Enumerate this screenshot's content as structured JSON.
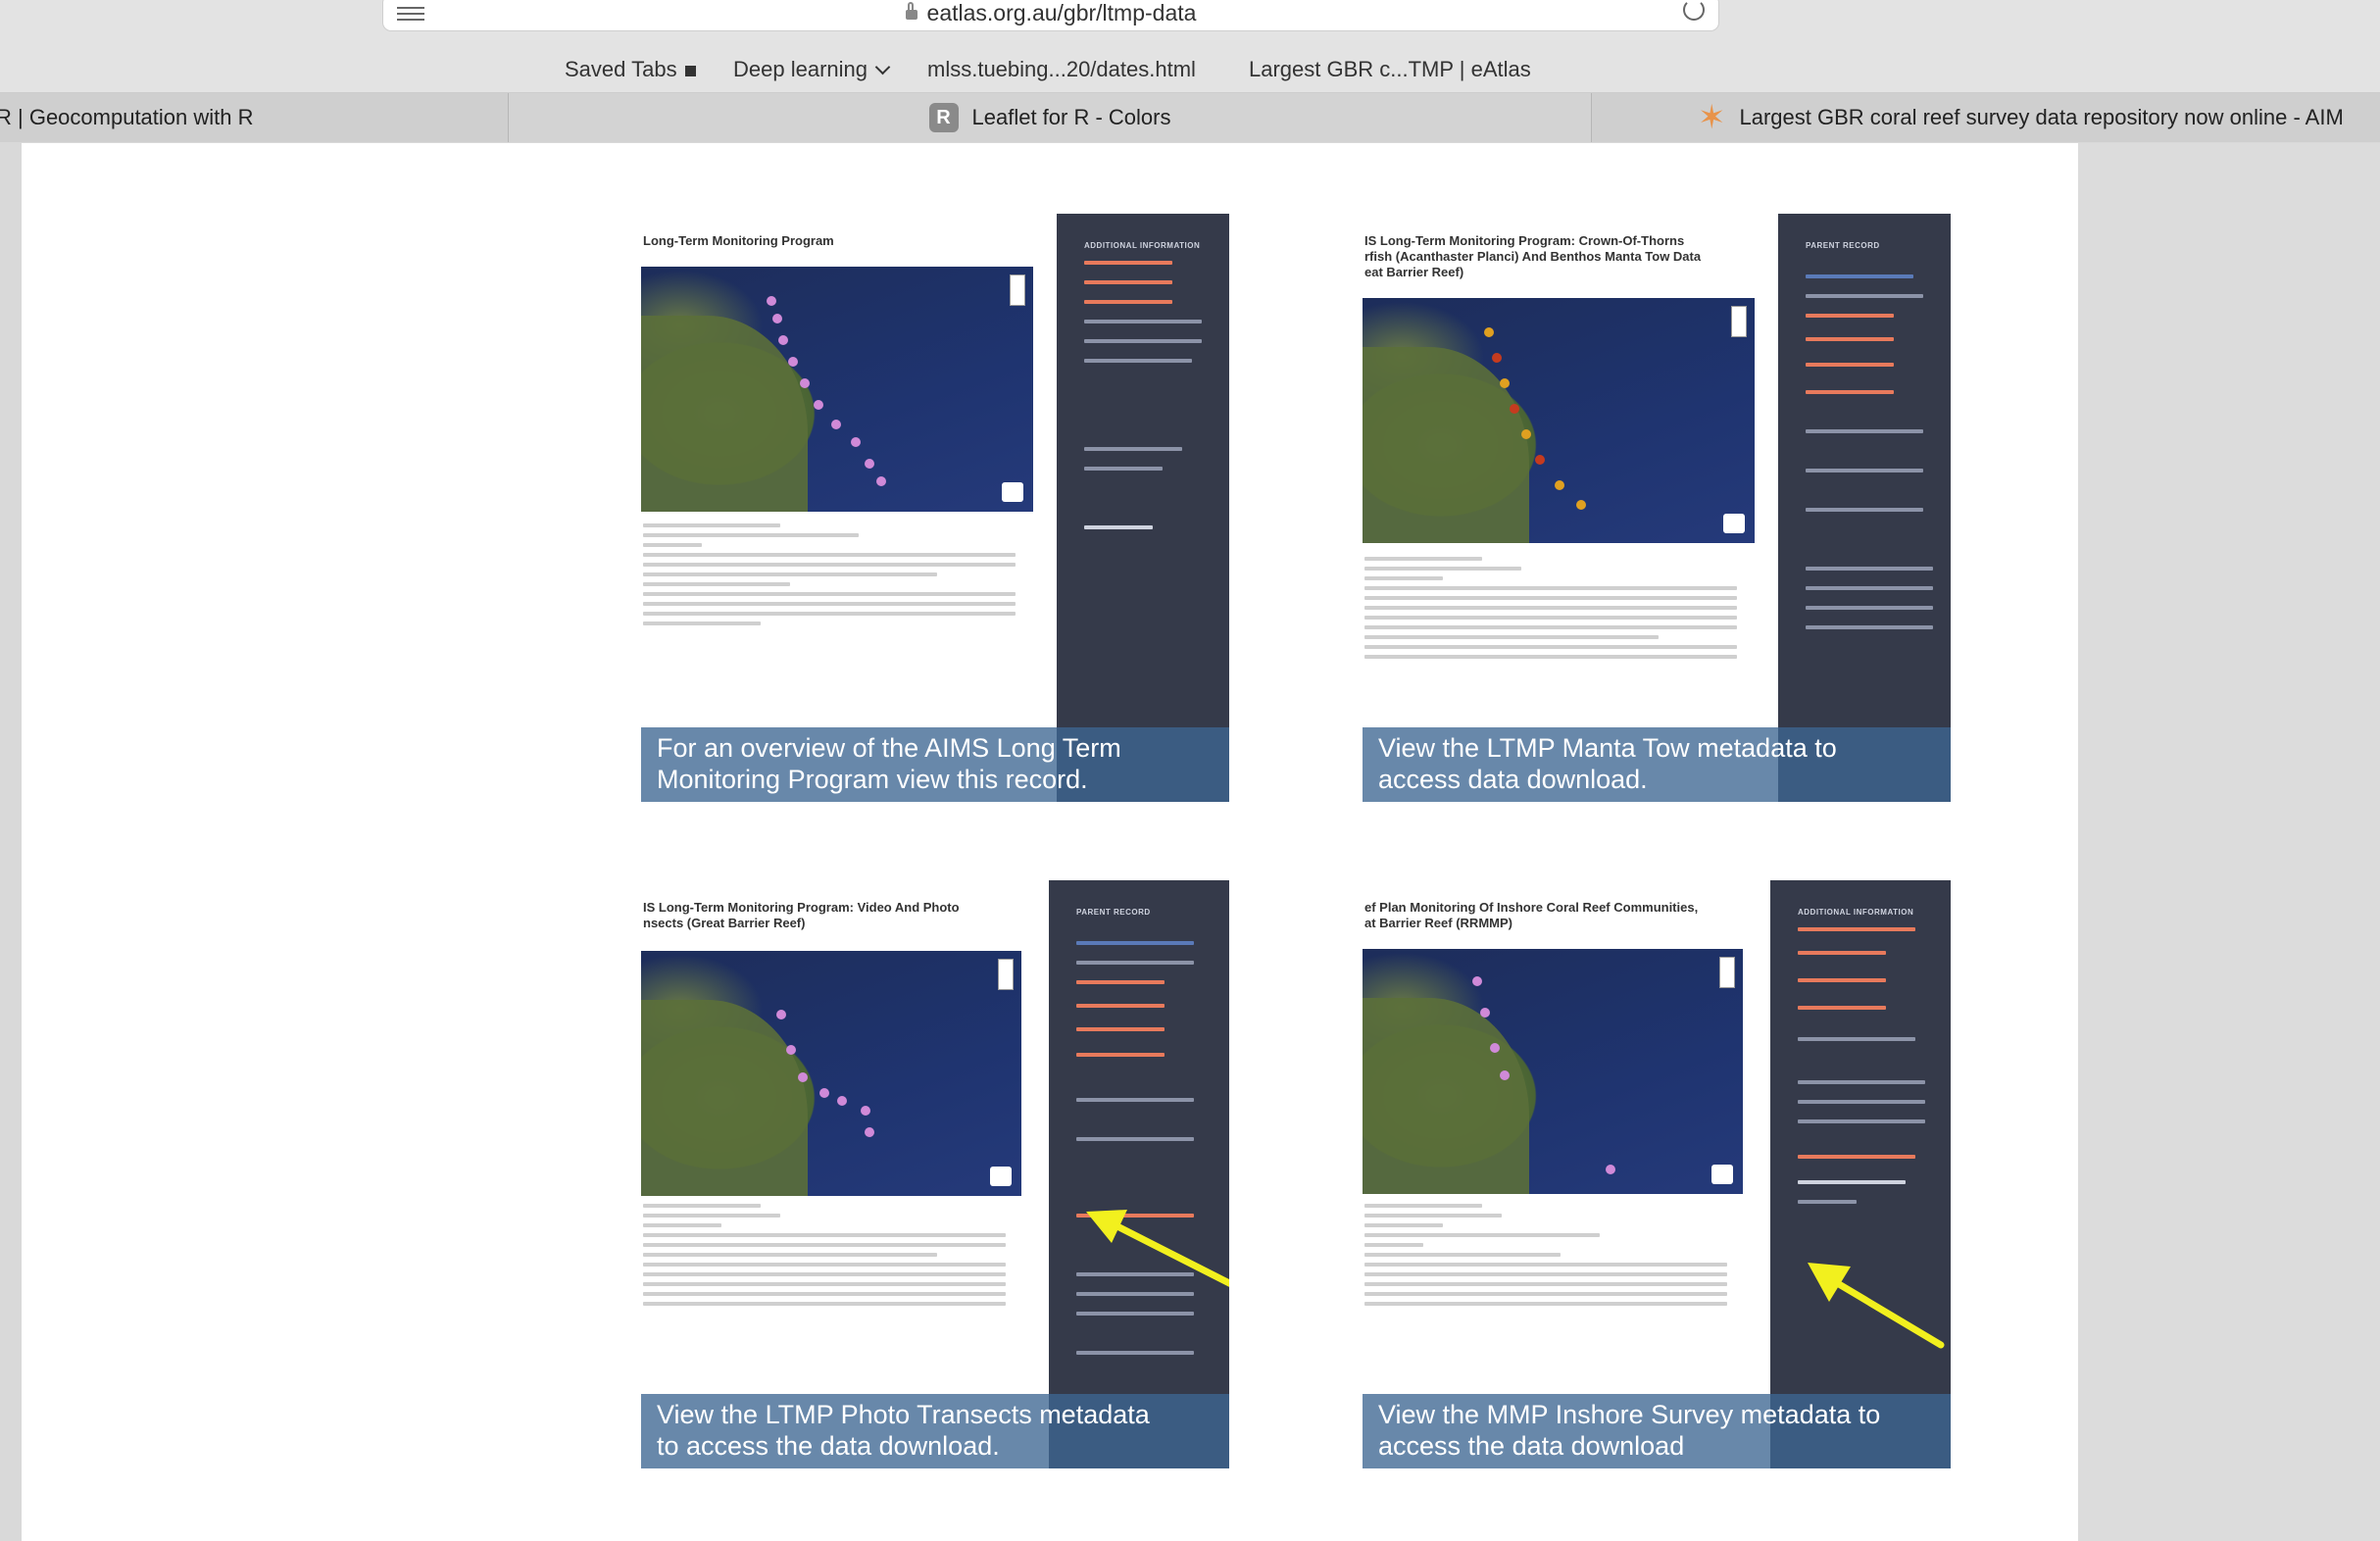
{
  "browser": {
    "url": "eatlas.org.au/gbr/ltmp-data",
    "bookmarks": [
      "Saved Tabs",
      "Deep learning",
      "mlss.tuebing...20/dates.html",
      "Largest GBR c...TMP | eAtlas"
    ],
    "tabs": [
      {
        "label": "R | Geocomputation with R"
      },
      {
        "label": "Leaflet for R - Colors",
        "icon_text": "R"
      },
      {
        "label": "Largest GBR coral reef survey data repository now online - AIM"
      }
    ]
  },
  "cards": [
    {
      "doc_title": "Long-Term Monitoring Program",
      "caption": "For an overview of the AIMS Long Term\nMonitoring Program view this record.",
      "side_heading": "ADDITIONAL INFORMATION"
    },
    {
      "doc_title": "IS Long-Term Monitoring Program: Crown-Of-Thorns\nrfish (Acanthaster Planci) And Benthos Manta Tow Data\neat Barrier Reef)",
      "caption": "View the LTMP Manta Tow metadata to\naccess data download.",
      "side_heading": "PARENT RECORD"
    },
    {
      "doc_title": "IS Long-Term Monitoring Program: Video And Photo\nnsects (Great Barrier Reef)",
      "caption": "View the LTMP Photo Transects metadata\nto access the data download.",
      "side_heading": "PARENT RECORD"
    },
    {
      "doc_title": "ef Plan Monitoring Of Inshore Coral Reef Communities,\nat Barrier Reef (RRMMP)",
      "caption": "View the MMP Inshore Survey metadata to\naccess the data download",
      "side_heading": "ADDITIONAL INFORMATION"
    }
  ],
  "colors": {
    "caption_bg": "#3e6692",
    "sidebar_bg": "#353a4a",
    "arrow": "#f2f01e",
    "reef_pink": "#d08ad8",
    "reef_orange": "#e0a020"
  }
}
